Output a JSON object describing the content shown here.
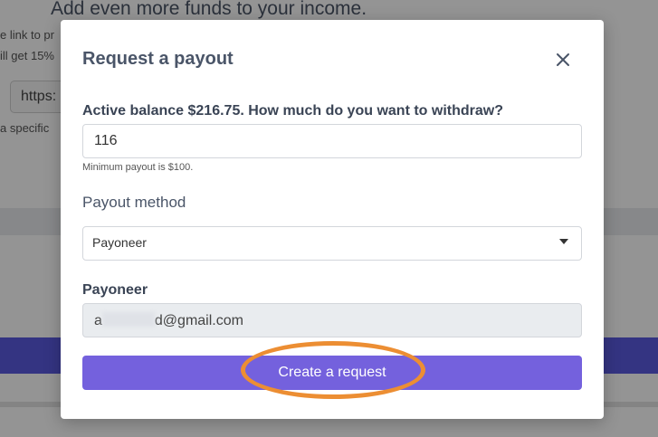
{
  "background": {
    "heading": "Add even more funds to your income.",
    "line1": "e link to pr",
    "line2": "ill get 15%",
    "url_value": "https:",
    "line3": "a specific"
  },
  "modal": {
    "title": "Request a payout",
    "close_icon": "close-icon",
    "balance_label": "Active balance $216.75. How much do you want to withdraw?",
    "amount_value": "116",
    "amount_hint": "Minimum payout is $100.",
    "method_label": "Payout method",
    "method_selected": "Payoneer",
    "payoneer_label": "Payoneer",
    "email_prefix": "a",
    "email_suffix": "d@gmail.com",
    "submit_label": "Create a request"
  },
  "colors": {
    "accent": "#7461dd",
    "highlight": "#ec8e33"
  }
}
